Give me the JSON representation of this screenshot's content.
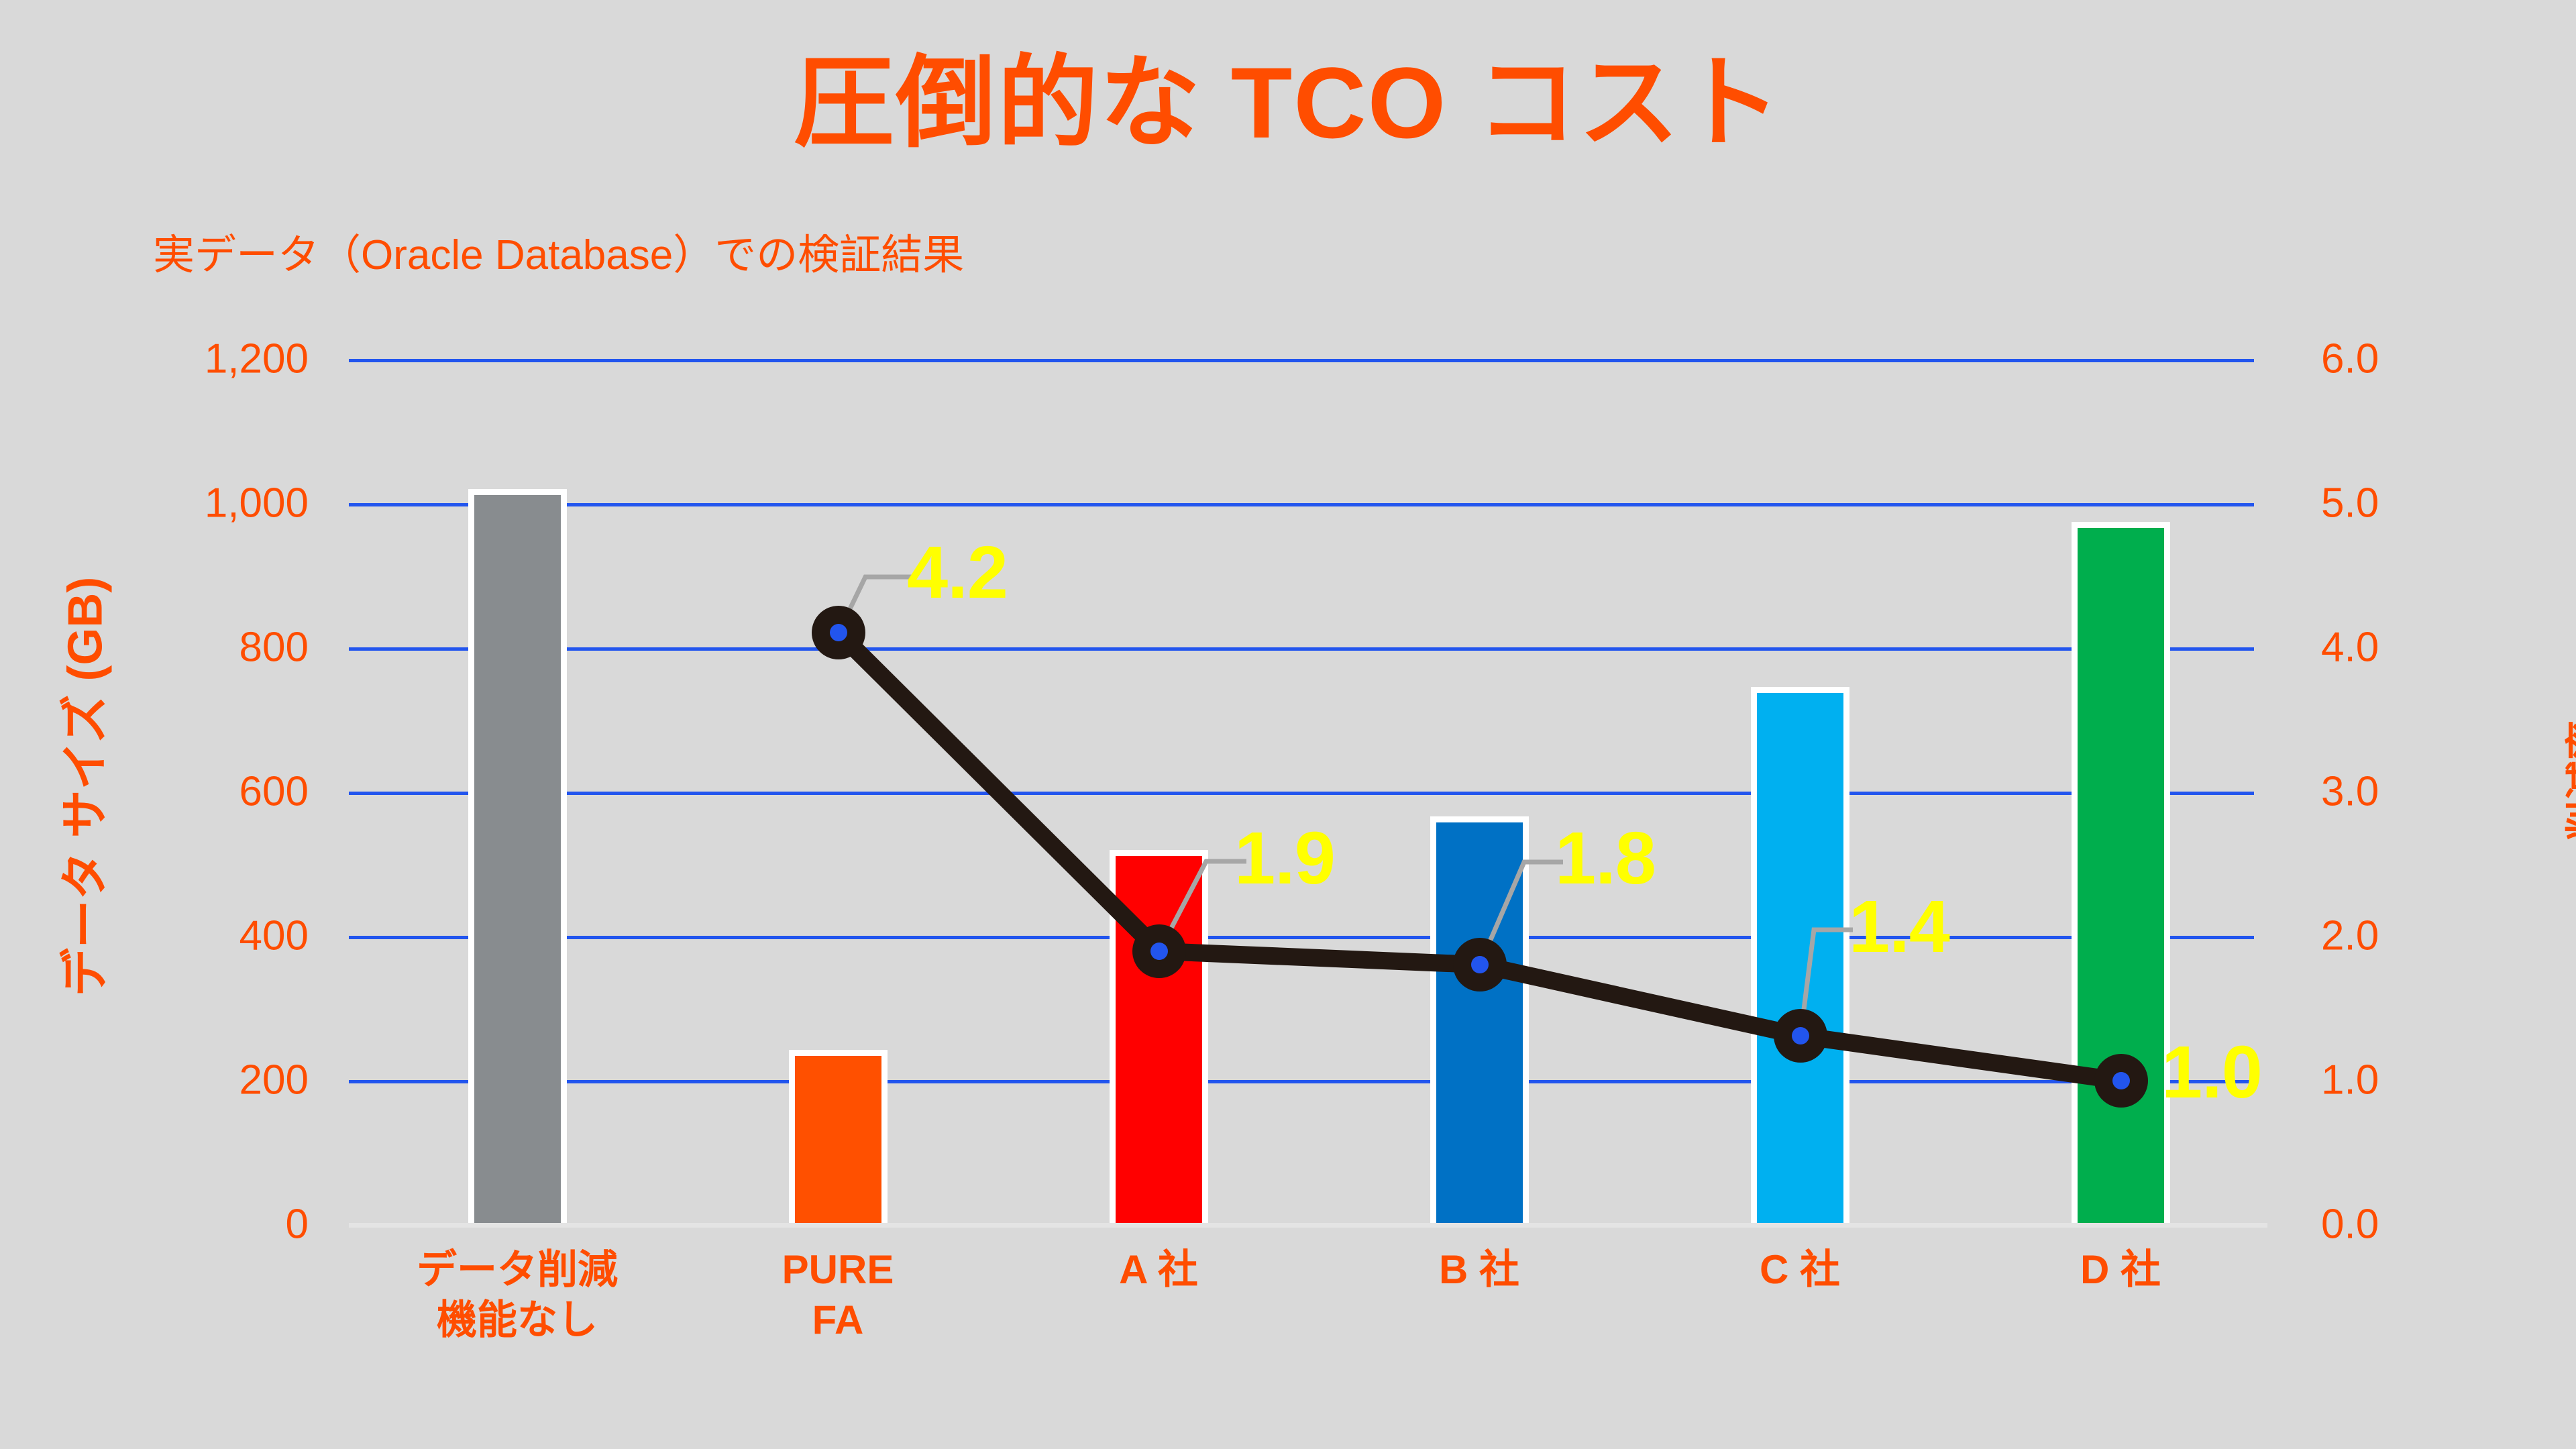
{
  "header": {
    "title": "圧倒的な TCO コスト",
    "subtitle": "実データ（Oracle Database）での検証結果"
  },
  "axes": {
    "left_title": "データ サイズ (GB)",
    "right_title": "削減率",
    "left_ticks": [
      "1,200",
      "1,000",
      "800",
      "600",
      "400",
      "200",
      "0"
    ],
    "right_ticks": [
      "6.0",
      "5.0",
      "4.0",
      "3.0",
      "2.0",
      "1.0",
      "0.0"
    ]
  },
  "colors": {
    "background": "#d9d9d9",
    "accent": "#FF4D00",
    "gridline": "#2255EE",
    "line": "#231812",
    "marker_center": "#2255EE",
    "value_label": "#FFFF00",
    "bar_border": "#ffffff"
  },
  "categories": [
    {
      "line1": "データ削減",
      "line2": "機能なし"
    },
    {
      "line1": "PURE",
      "line2": "FA"
    },
    {
      "line1": "A 社",
      "line2": ""
    },
    {
      "line1": "B 社",
      "line2": ""
    },
    {
      "line1": "C 社",
      "line2": ""
    },
    {
      "line1": "D 社",
      "line2": ""
    }
  ],
  "value_labels": [
    "4.2",
    "1.9",
    "1.8",
    "1.4",
    "1.0"
  ],
  "chart_data": {
    "type": "bar",
    "title": "圧倒的な TCO コスト",
    "subtitle": "実データ（Oracle Database）での検証結果",
    "categories": [
      "データ削減機能なし",
      "PURE FA",
      "A 社",
      "B 社",
      "C 社",
      "D 社"
    ],
    "xlabel": "",
    "ylabel": "データ サイズ (GB)",
    "ylabel_secondary": "削減率",
    "ylim": [
      0,
      1200
    ],
    "ylim_secondary": [
      0,
      6.0
    ],
    "yticks": [
      0,
      200,
      400,
      600,
      800,
      1000,
      1200
    ],
    "yticks_secondary": [
      0.0,
      1.0,
      2.0,
      3.0,
      4.0,
      5.0,
      6.0
    ],
    "grid": true,
    "legend": "none",
    "series": [
      {
        "name": "データ サイズ (GB)",
        "type": "bar",
        "axis": "left",
        "values": [
          1020,
          242,
          519,
          565,
          745,
          975
        ],
        "colors": [
          "#888C8F",
          "#FF5000",
          "#FF0000",
          "#0071C5",
          "#00B0F0",
          "#00AE4D"
        ]
      },
      {
        "name": "削減率",
        "type": "line",
        "axis": "right",
        "values": [
          null,
          4.2,
          1.9,
          1.8,
          1.4,
          1.0
        ],
        "labels": [
          null,
          "4.2",
          "1.9",
          "1.8",
          "1.4",
          "1.0"
        ],
        "color": "#231812",
        "marker_color": "#231812",
        "marker_center_color": "#2255EE",
        "label_color": "#FFFF00"
      }
    ]
  }
}
